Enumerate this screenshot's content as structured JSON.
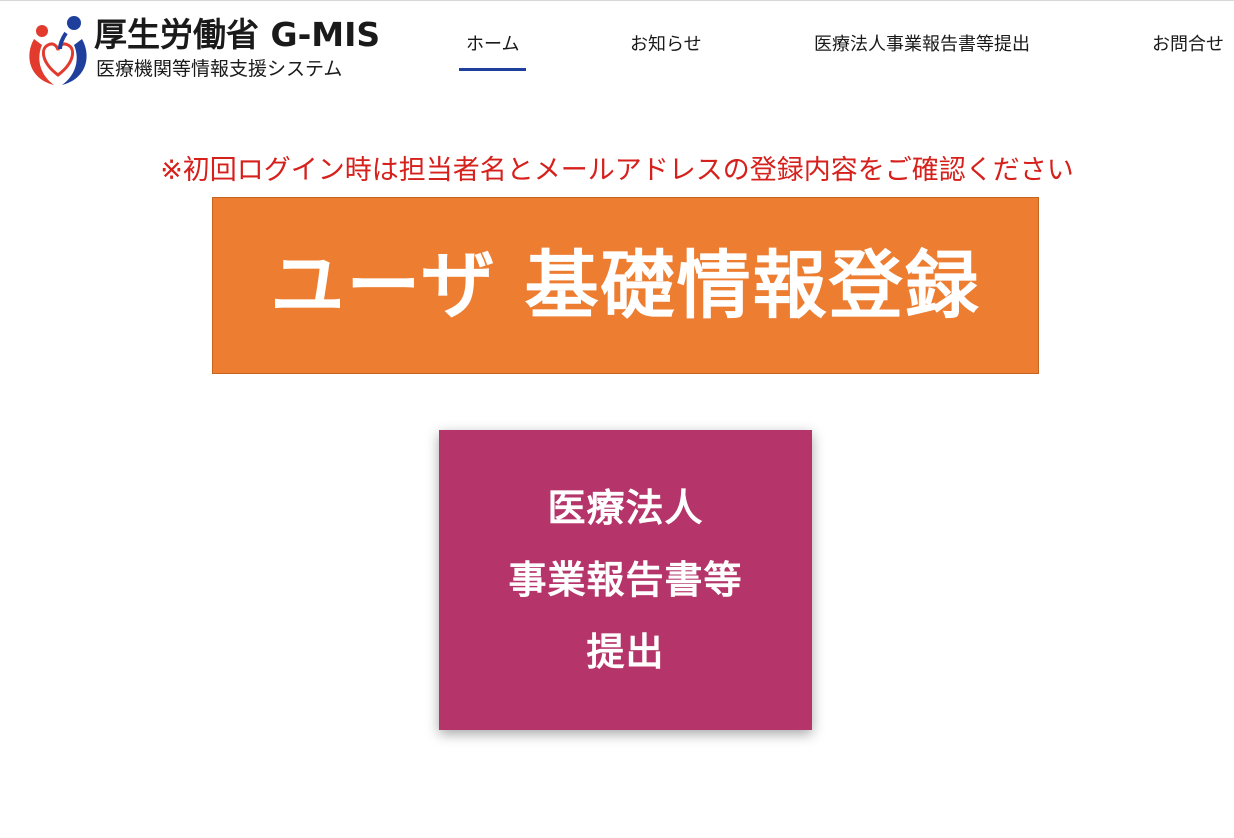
{
  "header": {
    "logo_title": "厚生労働省 G-MIS",
    "logo_subtitle": "医療機関等情報支援システム",
    "logo_colors": {
      "red": "#e23b2e",
      "blue": "#1f3f9c"
    }
  },
  "nav": {
    "items": [
      {
        "label": "ホーム",
        "active": true
      },
      {
        "label": "お知らせ",
        "active": false
      },
      {
        "label": "医療法人事業報告書等提出",
        "active": false
      },
      {
        "label": "お問合せ",
        "active": false
      }
    ],
    "active_color": "#1f3f9c"
  },
  "notice": {
    "text": "※初回ログイン時は担当者名とメールアドレスの登録内容をご確認ください",
    "color": "#d6201c"
  },
  "banner": {
    "label": "ユーザ 基礎情報登録",
    "background": "#ed7d31"
  },
  "tile": {
    "lines": [
      "医療法人",
      "事業報告書等",
      "提出"
    ],
    "background": "#b5346a"
  }
}
